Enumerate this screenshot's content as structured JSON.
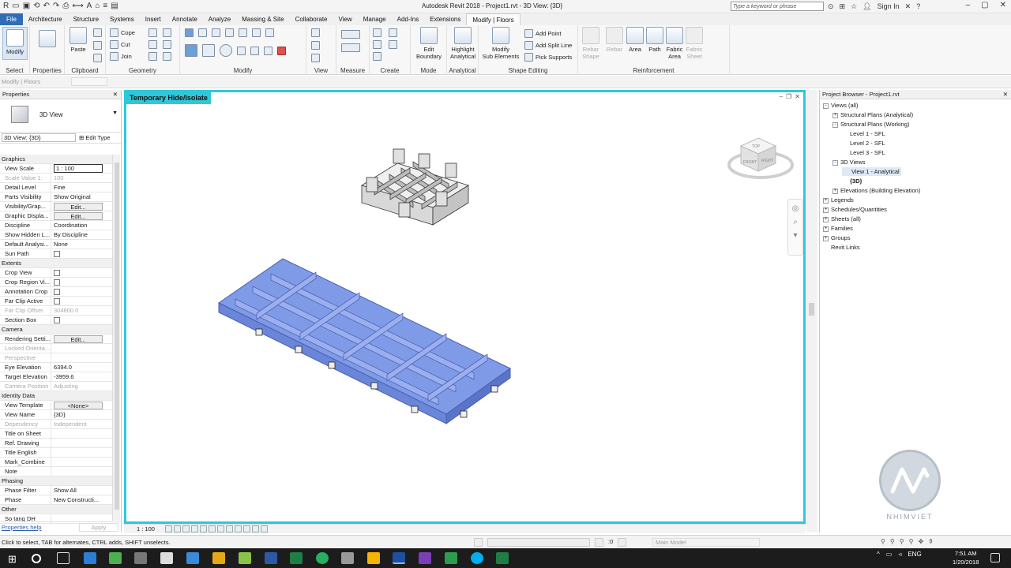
{
  "titlebar": {
    "app_title": "Autodesk Revit 2018 -    Project1.rvt - 3D View: {3D}",
    "search_placeholder": "Type a keyword or phrase",
    "sign_in": "Sign In"
  },
  "tabs": [
    "File",
    "Architecture",
    "Structure",
    "Systems",
    "Insert",
    "Annotate",
    "Analyze",
    "Massing & Site",
    "Collaborate",
    "View",
    "Manage",
    "Add-Ins",
    "Extensions",
    "Modify | Floors"
  ],
  "active_tab": "Modify | Floors",
  "ribbon": {
    "panels": {
      "select": "Select",
      "properties": "Properties",
      "clipboard": "Clipboard",
      "geometry": "Geometry",
      "modify": "Modify",
      "view": "View",
      "measure": "Measure",
      "create": "Create",
      "mode": "Mode",
      "analytical": "Analytical",
      "shape_editing": "Shape Editing",
      "reinforcement": "Reinforcement"
    },
    "buttons": {
      "modify": "Modify",
      "paste": "Paste",
      "cope": "Cope",
      "cut": "Cut",
      "join": "Join",
      "edit_boundary_1": "Edit",
      "edit_boundary_2": "Boundary",
      "highlight_1": "Highlight",
      "highlight_2": "Analytical",
      "modify_sub_1": "Modify",
      "modify_sub_2": "Sub Elements",
      "add_point": "Add Point",
      "add_split_line": "Add Split Line",
      "pick_supports": "Pick Supports",
      "rebar_1": "Rebar",
      "rebar_2": "Shape",
      "rebar_3": "Rebar",
      "area": "Area",
      "path": "Path",
      "fabric_area_1": "Fabric",
      "fabric_area_2": "Area",
      "fabric_sheet_1": "Fabric",
      "fabric_sheet_2": "Sheet"
    }
  },
  "options_bar": {
    "context": "Modify | Floors"
  },
  "properties": {
    "title": "Properties",
    "type_name": "3D View",
    "instance_selector": "3D View: {3D}",
    "edit_type": "Edit Type",
    "rows": [
      {
        "group": "Graphics"
      },
      {
        "k": "View Scale",
        "v": "1 : 100",
        "kind": "input"
      },
      {
        "k": "Scale Value    1:",
        "v": "100",
        "dis": true
      },
      {
        "k": "Detail Level",
        "v": "Fine"
      },
      {
        "k": "Parts Visibility",
        "v": "Show Original"
      },
      {
        "k": "Visibility/Grap...",
        "v": "Edit...",
        "kind": "btn"
      },
      {
        "k": "Graphic Displa...",
        "v": "Edit...",
        "kind": "btn"
      },
      {
        "k": "Discipline",
        "v": "Coordination"
      },
      {
        "k": "Show Hidden L...",
        "v": "By Discipline"
      },
      {
        "k": "Default Analysi...",
        "v": "None"
      },
      {
        "k": "Sun Path",
        "v": "",
        "kind": "cb"
      },
      {
        "group": "Extents"
      },
      {
        "k": "Crop View",
        "v": "",
        "kind": "cb"
      },
      {
        "k": "Crop Region Vi...",
        "v": "",
        "kind": "cb"
      },
      {
        "k": "Annotation Crop",
        "v": "",
        "kind": "cb"
      },
      {
        "k": "Far Clip Active",
        "v": "",
        "kind": "cb"
      },
      {
        "k": "Far Clip Offset",
        "v": "304800.0",
        "dis": true
      },
      {
        "k": "Section Box",
        "v": "",
        "kind": "cb"
      },
      {
        "group": "Camera"
      },
      {
        "k": "Rendering Setti...",
        "v": "Edit...",
        "kind": "btn"
      },
      {
        "k": "Locked Orienta...",
        "v": "",
        "dis": true
      },
      {
        "k": "Perspective",
        "v": "",
        "dis": true
      },
      {
        "k": "Eye Elevation",
        "v": "6394.0"
      },
      {
        "k": "Target Elevation",
        "v": "-3959.6"
      },
      {
        "k": "Camera Position",
        "v": "Adjusting",
        "dis": true
      },
      {
        "group": "Identity Data"
      },
      {
        "k": "View Template",
        "v": "<None>",
        "kind": "btn"
      },
      {
        "k": "View Name",
        "v": "{3D}"
      },
      {
        "k": "Dependency",
        "v": "Independent",
        "dis": true
      },
      {
        "k": "Title on Sheet",
        "v": ""
      },
      {
        "k": "Ref. Drawing",
        "v": ""
      },
      {
        "k": "Title English",
        "v": ""
      },
      {
        "k": "Mark_Combine",
        "v": ""
      },
      {
        "k": "Note",
        "v": ""
      },
      {
        "group": "Phasing"
      },
      {
        "k": "Phase Filter",
        "v": "Show All"
      },
      {
        "k": "Phase",
        "v": "New Constructi..."
      },
      {
        "group": "Other"
      },
      {
        "k": "So tang DH",
        "v": ""
      }
    ],
    "help_link": "Properties help",
    "apply": "Apply"
  },
  "view": {
    "label": "Temporary Hide/Isolate",
    "scale": "1 : 100",
    "viewcube_top": "TOP",
    "viewcube_front": "FRONT",
    "viewcube_right": "RIGHT"
  },
  "project_browser": {
    "title": "Project Browser - Project1.rvt",
    "nodes": [
      {
        "label": "Views (all)",
        "depth": 0,
        "toggle": "-"
      },
      {
        "label": "Structural Plans (Analytical)",
        "depth": 1,
        "toggle": "+"
      },
      {
        "label": "Structural Plans (Working)",
        "depth": 1,
        "toggle": "-"
      },
      {
        "label": "Level 1 - SFL",
        "depth": 2,
        "toggle": ""
      },
      {
        "label": "Level 2 - SFL",
        "depth": 2,
        "toggle": ""
      },
      {
        "label": "Level 3 - SFL",
        "depth": 2,
        "toggle": ""
      },
      {
        "label": "3D Views",
        "depth": 1,
        "toggle": "-"
      },
      {
        "label": "View 1 - Analytical",
        "depth": 2,
        "toggle": "",
        "selected": true
      },
      {
        "label": "{3D}",
        "depth": 2,
        "toggle": "",
        "bold": true
      },
      {
        "label": "Elevations (Building Elevation)",
        "depth": 1,
        "toggle": "+"
      },
      {
        "label": "Legends",
        "depth": 0,
        "toggle": "+"
      },
      {
        "label": "Schedules/Quantities",
        "depth": 0,
        "toggle": "+"
      },
      {
        "label": "Sheets (all)",
        "depth": 0,
        "toggle": "+"
      },
      {
        "label": "Families",
        "depth": 0,
        "toggle": "+"
      },
      {
        "label": "Groups",
        "depth": 0,
        "toggle": "+"
      },
      {
        "label": "Revit Links",
        "depth": 0,
        "toggle": ""
      }
    ]
  },
  "watermark": {
    "text": "NHIMVIET"
  },
  "status": {
    "message": "Click to select, TAB for alternates, CTRL adds, SHIFT unselects.",
    "model": "Main Model",
    "filter_count": ":0"
  },
  "taskbar": {
    "lang": "ENG",
    "time": "7:51 AM",
    "date": "1/20/2018"
  },
  "colors": {
    "file_tab": "#2f6db5",
    "view_border": "#2ec8d8",
    "slab": "#7f9be8"
  }
}
